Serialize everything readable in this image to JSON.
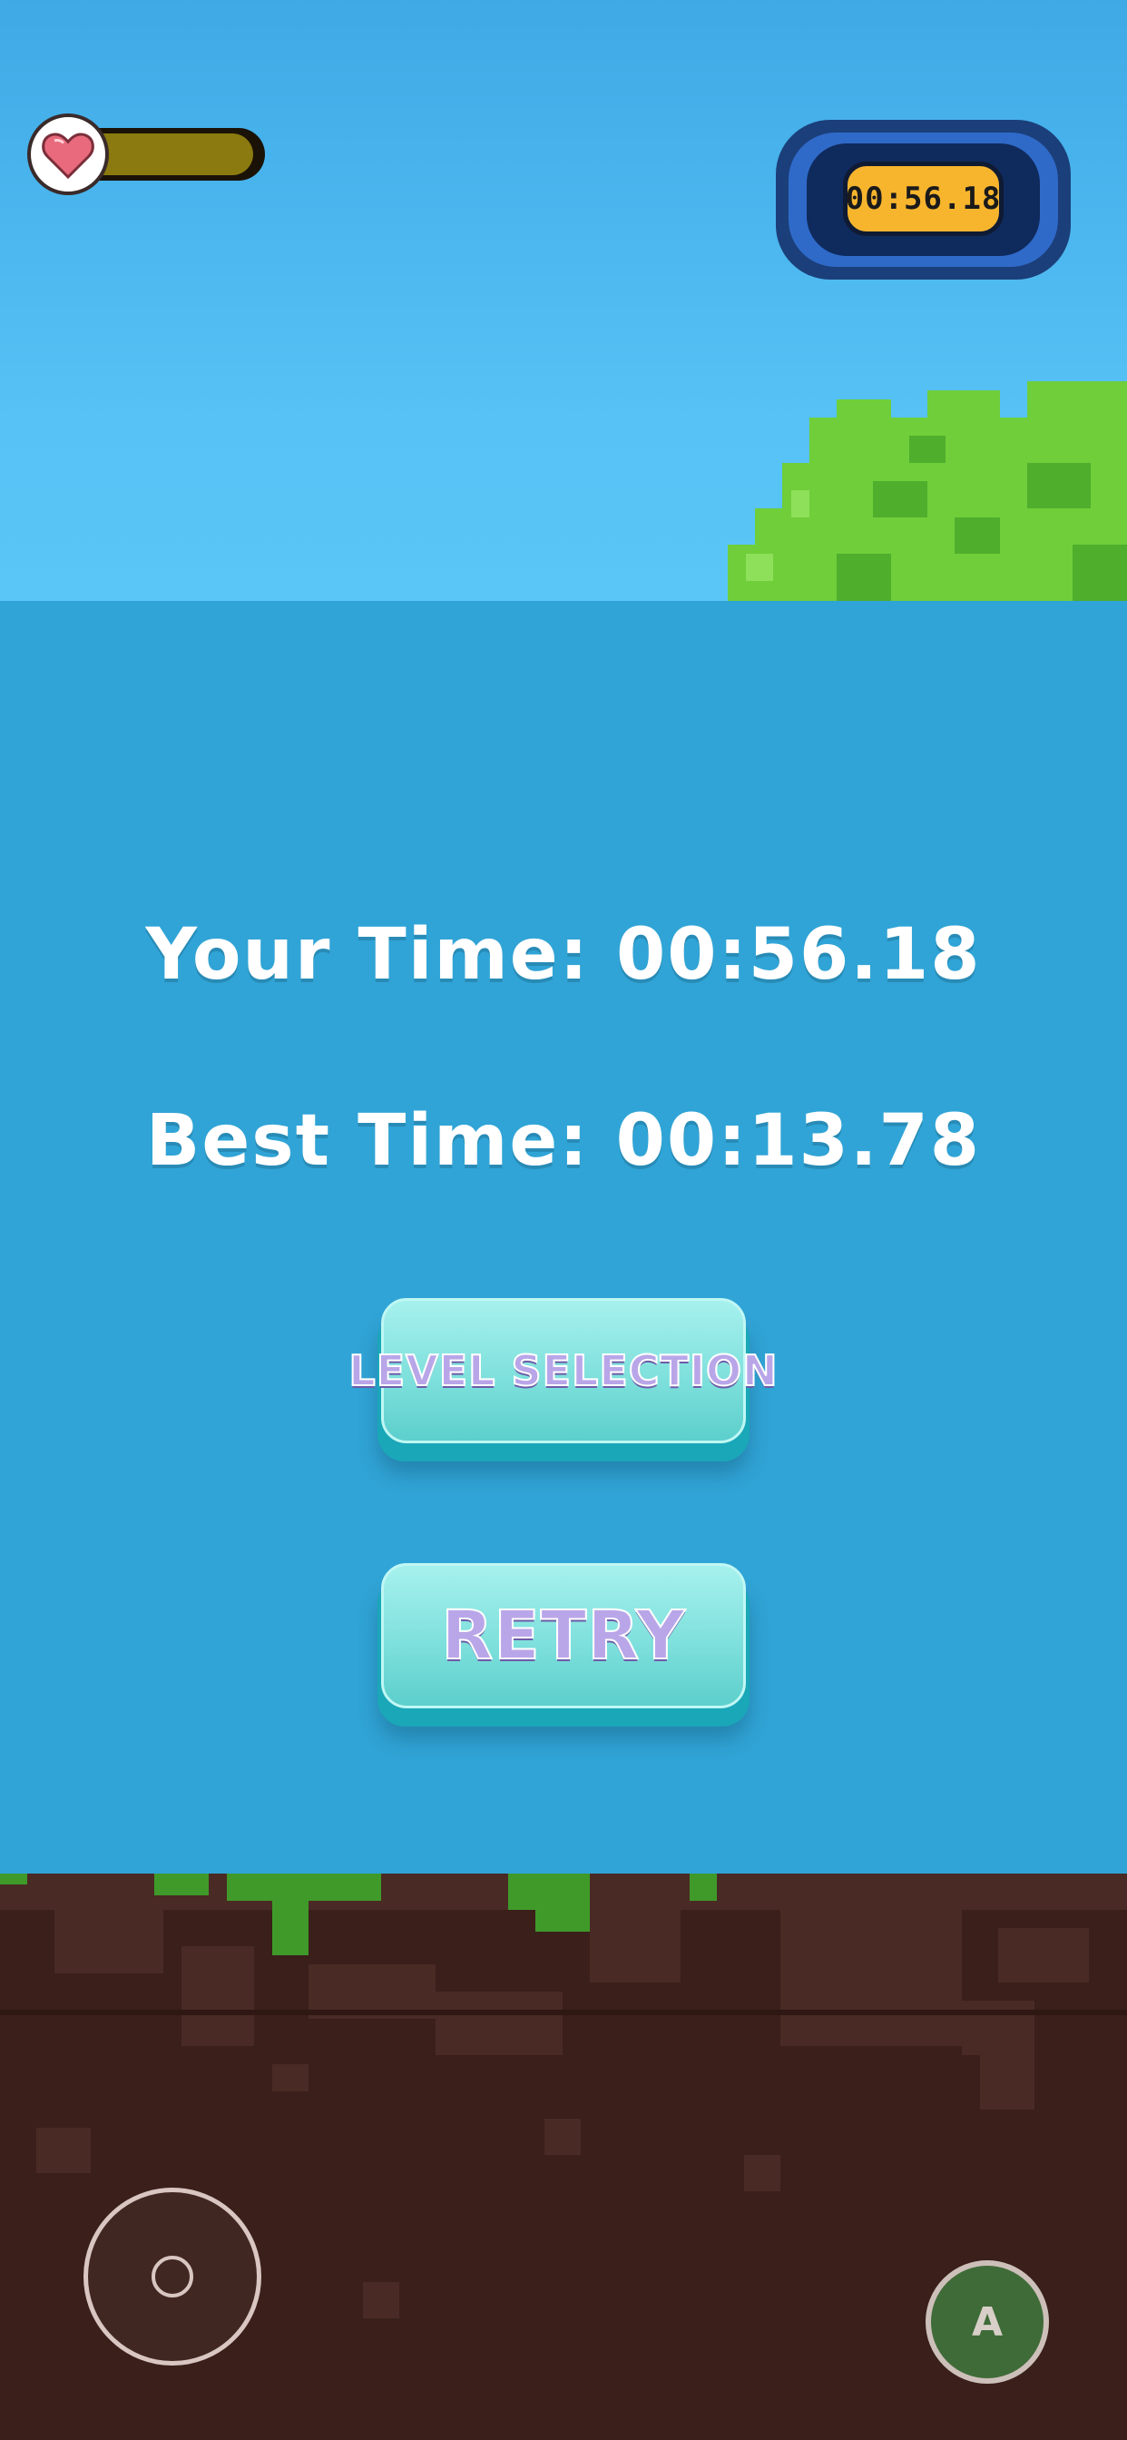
{
  "hud": {
    "health_level": 0.95,
    "health_icon": "heart-icon",
    "timer_value": "00:56.18"
  },
  "results": {
    "your_time": "Your Time: 00:56.18",
    "best_time": "Best Time: 00:13.78"
  },
  "buttons": {
    "level_selection": "LEVEL SELECTION",
    "retry": "RETRY"
  },
  "controls": {
    "action_label": "A"
  },
  "colors": {
    "sky": "#56c2f5",
    "panel": "#30a4d6",
    "ground": "#3a1f1a",
    "grass": "#3f9a2a",
    "timer_pill": "#f7b52e",
    "button_face": "#7fe0dc"
  }
}
